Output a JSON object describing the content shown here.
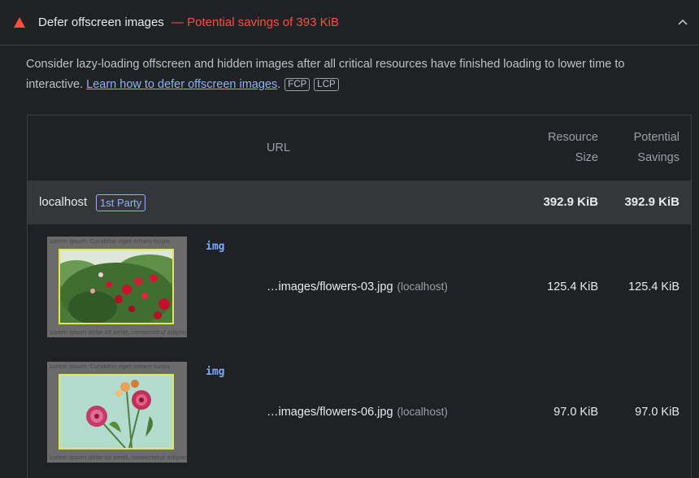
{
  "audit": {
    "title": "Defer offscreen images",
    "savings": "— Potential savings of 393 KiB",
    "icon": "warning-triangle-icon",
    "status_color": "#ff4e42"
  },
  "description": {
    "text": "Consider lazy-loading offscreen and hidden images after all critical resources have finished loading to lower time to interactive. ",
    "link_text": "Learn how to defer offscreen images",
    "after_link": ".",
    "metrics": [
      "FCP",
      "LCP"
    ]
  },
  "table": {
    "headers": {
      "url": "URL",
      "size_line1": "Resource",
      "size_line2": "Size",
      "savings_line1": "Potential",
      "savings_line2": "Savings"
    },
    "group": {
      "name": "localhost",
      "badge": "1st Party",
      "size": "392.9 KiB",
      "savings": "392.9 KiB"
    },
    "items": [
      {
        "node": "img",
        "url": "…images/flowers-03.jpg",
        "origin": "(localhost)",
        "size": "125.4 KiB",
        "savings": "125.4 KiB",
        "thumb_text_top": "Lorem ipsum. Curabitur eget ornare turpis",
        "thumb_text_bottom": "Lorem ipsum dolor sit amet, consectetur adipiscing elit"
      },
      {
        "node": "img",
        "url": "…images/flowers-06.jpg",
        "origin": "(localhost)",
        "size": "97.0 KiB",
        "savings": "97.0 KiB",
        "thumb_text_top": "Lorem ipsum. Curabitur eget ornare turpis",
        "thumb_text_bottom": "Lorem ipsum dolor sit amet, consectetur adipiscing elit"
      }
    ]
  }
}
